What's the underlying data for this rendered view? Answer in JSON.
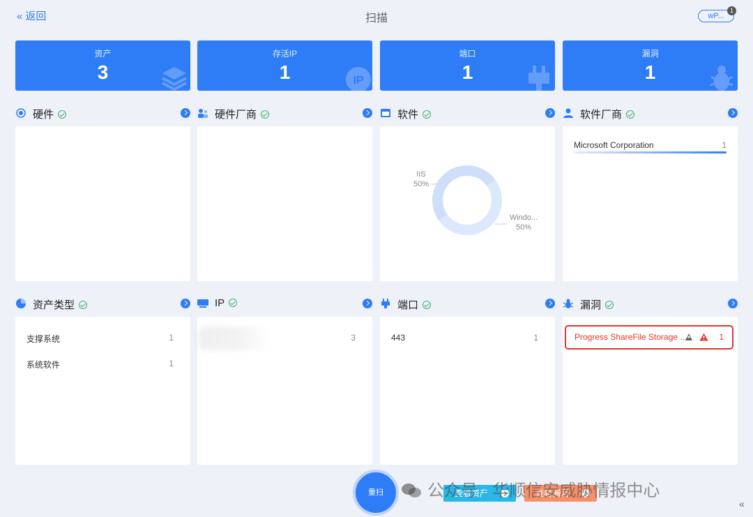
{
  "header": {
    "back_label": "返回",
    "back_chevron": "«",
    "title": "扫描",
    "user_label": "wP...",
    "user_badge": "1"
  },
  "stats": [
    {
      "label": "资产",
      "value": "3",
      "icon": "layers-icon"
    },
    {
      "label": "存活IP",
      "value": "1",
      "icon": "ip-icon"
    },
    {
      "label": "端口",
      "value": "1",
      "icon": "plug-icon"
    },
    {
      "label": "漏洞",
      "value": "1",
      "icon": "bug-icon"
    }
  ],
  "sections": {
    "hardware": {
      "title": "硬件",
      "icon": "chip-icon"
    },
    "hardware_vendor": {
      "title": "硬件厂商",
      "icon": "vendor-icon"
    },
    "software": {
      "title": "软件",
      "icon": "window-icon"
    },
    "software_vendor": {
      "title": "软件厂商",
      "icon": "user-icon"
    },
    "asset_type": {
      "title": "资产类型",
      "icon": "pie-icon"
    },
    "ip": {
      "title": "IP",
      "icon": "monitor-icon"
    },
    "port": {
      "title": "端口",
      "icon": "plug-icon"
    },
    "vuln": {
      "title": "漏洞",
      "icon": "bug-icon"
    }
  },
  "software_chart": {
    "chart_data": {
      "type": "pie",
      "donut": true,
      "labels": [
        "IIS",
        "Windo..."
      ],
      "percents": [
        "50%",
        "50%"
      ],
      "values": [
        50,
        50
      ],
      "colors": [
        "#dce8fb",
        "#cfdff9"
      ]
    }
  },
  "software_vendor_list": [
    {
      "name": "Microsoft Corporation",
      "count": "1",
      "share": 1.0
    }
  ],
  "asset_type_list": [
    {
      "name": "支撑系统",
      "count": "1"
    },
    {
      "name": "系统软件",
      "count": "1"
    }
  ],
  "ip_list": [
    {
      "count": "3"
    }
  ],
  "port_list": [
    {
      "port": "443",
      "count": "1"
    }
  ],
  "vuln_list": [
    {
      "name": "Progress ShareFile Storage ...",
      "count": "1",
      "color": "#e0362c"
    }
  ],
  "footer": {
    "rescan_label": "重扫",
    "view_assets_label": "查看资产",
    "view_vulns_label": "查看漏洞",
    "watermark": "公众号 · 华顺信安威胁情报中心",
    "collapse_glyph": "«"
  }
}
